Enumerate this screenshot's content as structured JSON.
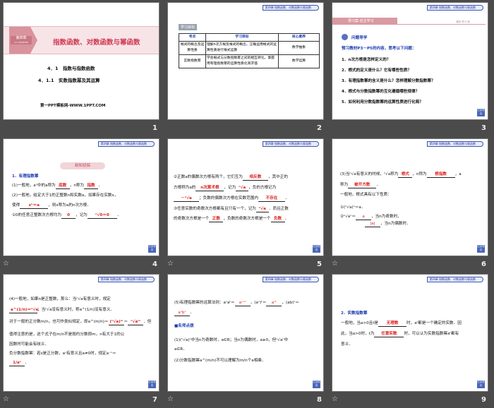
{
  "header_badge": "第四章 指数函数、对数函数与幂函数",
  "back_label": "栏目导引",
  "slides": [
    {
      "number": "1",
      "chapter": "第四章",
      "chapter_en": "4.1 CHAPTER",
      "title": "指数函数、对数函数与幂函数",
      "sub1": "4．1　指数与指数函数",
      "sub2": "4．1.1　实数指数幂及其运算",
      "footer": "第一PPT模板网-WWW.1PPT.COM"
    },
    {
      "number": "2",
      "label": "学习目标",
      "headers": [
        "考点",
        "学习目标",
        "核心素养"
      ],
      "rows": [
        [
          "根式的概念及运算性质",
          "理解n次方根及根式的概念，正确运用根式的运算性质进行根式运算",
          "数学抽象"
        ],
        [
          "实数指数幂",
          "学会根式与分数指数幂之间的相互转化，掌握用有理指数幂的运算性质化简求值",
          "数学运算"
        ]
      ]
    },
    {
      "number": "3",
      "banner": "预习案·自主学习",
      "banner_right": "课前·预习·案",
      "q_title": "问题导学",
      "intro": "预习教材P3－P5的内容，思考以下问题：",
      "questions": [
        "1．n次方根是怎样定义的？",
        "2．根式的定义是什么？它有哪些性质？",
        "3．有理指数幂的含义是什么？怎样理解分数指数幂？",
        "4．根式与分数指数幂的互化遵循哪些规律？",
        "5．如何利用分数指数幂的运算性质进行化简？"
      ]
    },
    {
      "number": "4",
      "banner": "新知初探",
      "h": "1．有理指数幂",
      "l1a": "(1)一般地，aⁿ中的a称为",
      "f1": "底数",
      "l1b": "，n称为",
      "f2": "指数",
      "l2": "(2)一般地，给定大于1的正整数n和实数a，如果存在实数x，",
      "l3a": "使得",
      "f3": "xⁿ＝a",
      "l3b": "，则x称为a的n次方根．",
      "l4a": "①0的任意正整数次方根均为",
      "f4": "0",
      "l4b": "，记为",
      "f5": "ⁿ√0＝0"
    },
    {
      "number": "5",
      "l1a": "②正数a的偶数次方根有两个，它们互为",
      "f1": "相反数",
      "l1b": "，其中正的",
      "l2a": "方根称为a的",
      "f2": "n次算术根",
      "l2b": "，记为",
      "f3": "ⁿ√a",
      "l2c": "，负的方根记为",
      "f4": "－ⁿ√a",
      "l3b": "；负数的偶数次方根在实数范围内",
      "f5": "不存在",
      "l4a": "③任意实数的奇数次方根都有且只有一个，记为",
      "f6": "ⁿ√a",
      "l4b": "．而且正数",
      "l5a": "的奇数次方根是一个",
      "f7": "正数",
      "l5b": "，负数的奇数次方根是一个",
      "f8": "负数"
    },
    {
      "number": "6",
      "l1a": "(3)当ⁿ√a有意义的时候，ⁿ√a称为",
      "f1": "根式",
      "l1b": "，n称为",
      "f2": "根指数",
      "l1c": "，a",
      "l2a": "称为",
      "f3": "被开方数",
      "l3": "一般地，根式具有以下性质：",
      "l4": "①(ⁿ√a)ⁿ＝a．",
      "l5a": "②ⁿ√aⁿ＝",
      "f4": "a",
      "l5b": "，当n为奇数时，",
      "f5": "|a|",
      "l6b": "，当n为偶数时．"
    },
    {
      "number": "7",
      "l1": "(4)一般地，如果n是正整数，那么：当ⁿ√a有意义时，规定",
      "f1": "a^(1/n)＝ⁿ√a",
      "l2b": "；当ⁿ√a没有意义时，称a^(1/n)没有意义．",
      "l3a": "对于一般的正分数m/n，也可作类似规定，即a^(m/n)＝",
      "f2": "(ⁿ√a)ᵐ",
      "f3": "ⁿ√aᵐ",
      "l3b": "．但",
      "l4": "值得注意的是，这个式子在m/n不是既约分数即m，n有大于1的公",
      "l5": "因数时可能会有歧义．",
      "l6": "负分数指数幂：若s是正分数，aˢ有意义且a≠0时，规定a⁻ˢ＝",
      "f4": "1/aˢ"
    },
    {
      "number": "8",
      "l1a": "(5)有理指数幂的运算法则：aˢaᵗ＝",
      "f1": "aˢ⁺ᵗ",
      "l1b": "，(aˢ)ᵗ＝",
      "f2": "aˢᵗ",
      "l1c": "，(ab)ˢ＝",
      "f3": "aˢbˢ",
      "h": "■名师点拨",
      "l3": "(1)(ⁿ√a)ⁿ中当n为奇数时，a∈R；当n为偶数时，a≥0，但ⁿ√aⁿ中",
      "l4": "a∈R．",
      "l5": "(2)分数指数幂a^(m/n)不可以理解为m/n个a相乘．"
    },
    {
      "number": "9",
      "h": "2．实数指数幂",
      "l1a": "一般地，当a>0且t是",
      "f1": "无理数",
      "l1b": "时，aᵗ都是一个确定的实数．因",
      "l2a": "此，当a>0时，t为",
      "f2": "任意实数",
      "l2b": "时，可以认为实数指数幂aᵗ都有",
      "l3": "意义．"
    }
  ]
}
